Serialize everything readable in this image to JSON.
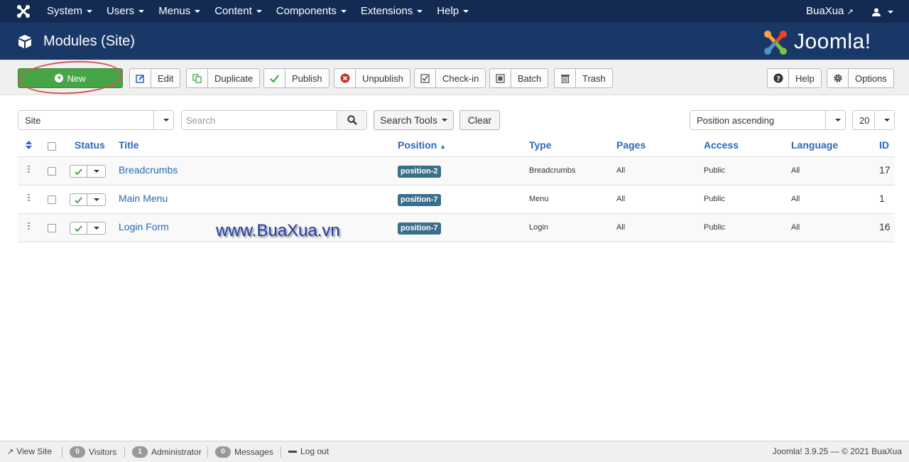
{
  "navbar": {
    "menu": [
      "System",
      "Users",
      "Menus",
      "Content",
      "Components",
      "Extensions",
      "Help"
    ],
    "user": "BuaXua"
  },
  "header": {
    "title": "Modules (Site)",
    "brand": "Joomla!"
  },
  "toolbar": {
    "new": "New",
    "edit": "Edit",
    "duplicate": "Duplicate",
    "publish": "Publish",
    "unpublish": "Unpublish",
    "checkin": "Check-in",
    "batch": "Batch",
    "trash": "Trash",
    "help": "Help",
    "options": "Options"
  },
  "filters": {
    "client": "Site",
    "search_placeholder": "Search",
    "search_tools": "Search Tools",
    "clear": "Clear",
    "ordering": "Position ascending",
    "limit": "20"
  },
  "table": {
    "headers": {
      "status": "Status",
      "title": "Title",
      "position": "Position",
      "type": "Type",
      "pages": "Pages",
      "access": "Access",
      "language": "Language",
      "id": "ID"
    },
    "rows": [
      {
        "title": "Breadcrumbs",
        "position": "position-2",
        "type": "Breadcrumbs",
        "pages": "All",
        "access": "Public",
        "language": "All",
        "id": "17"
      },
      {
        "title": "Main Menu",
        "position": "position-7",
        "type": "Menu",
        "pages": "All",
        "access": "Public",
        "language": "All",
        "id": "1"
      },
      {
        "title": "Login Form",
        "position": "position-7",
        "type": "Login",
        "pages": "All",
        "access": "Public",
        "language": "All",
        "id": "16"
      }
    ]
  },
  "watermark": "www.BuaXua.vn",
  "statusbar": {
    "view_site": "View Site",
    "visitors_count": "0",
    "visitors": "Visitors",
    "admin_count": "1",
    "admin": "Administrator",
    "messages_count": "0",
    "messages": "Messages",
    "logout": "Log out",
    "version": "Joomla! 3.9.25 — © 2021 BuaXua"
  },
  "colors": {
    "navbar": "#132b53",
    "header": "#1a3867",
    "new_button": "#46a546",
    "link": "#2a69b8",
    "badge": "#3a6f8a"
  }
}
